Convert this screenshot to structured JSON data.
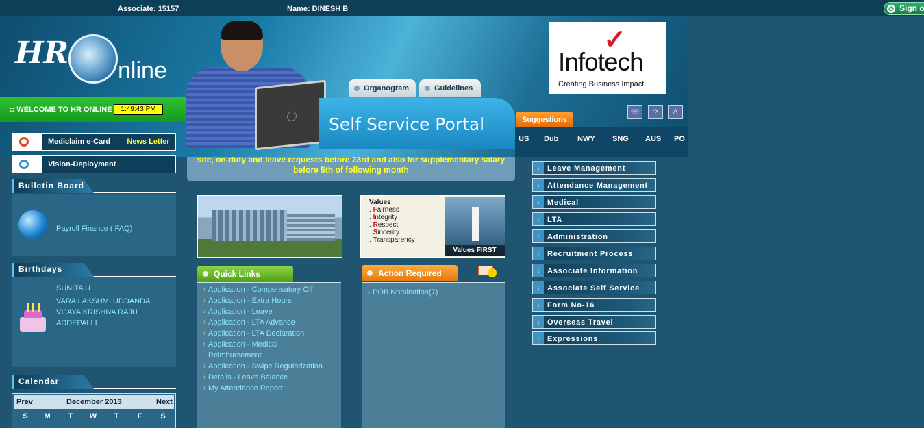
{
  "topbar": {
    "associate": "Associate: 15157",
    "name": "Name: DINESH B",
    "signout": "Sign o"
  },
  "header": {
    "logo_hr": "HR",
    "logo_online": "nline",
    "welcome": ":: WELCOME TO HR ONLINE",
    "clock": "1:49:43 PM",
    "tabs": [
      "Organogram",
      "Guidelines"
    ],
    "portal_title": "Self Service Portal",
    "brand": {
      "name": "Infotech",
      "tagline": "Creating Business Impact"
    },
    "suggestions": "Suggestions",
    "icons": [
      "phone-icon",
      "help-icon",
      "user-icon"
    ],
    "countries": [
      "US",
      "Dub",
      "NWY",
      "SNG",
      "AUS",
      "PO"
    ]
  },
  "ticker": {
    "line1": "site, on-duty and leave requests before 23rd and also for supplementary salary",
    "line2": "before 5th of following month"
  },
  "left": {
    "mediclaim": "Mediclaim e-Card",
    "newsletter": "News Letter",
    "vision": "Vision-Deployment",
    "bulletin_title": "Bulletin Board",
    "bulletin_link": "Payroll Finance ( FAQ)",
    "birthdays_title": "Birthdays",
    "birthdays": [
      "SUNITA U",
      "VARA LAKSHMI UDDANDA",
      "VIJAYA KRISHNA RAJU",
      "ADDEPALLI"
    ],
    "calendar_title": "Calendar",
    "calendar": {
      "prev": "Prev",
      "month": "December 2013",
      "next": "Next",
      "days": [
        "S",
        "M",
        "T",
        "W",
        "T",
        "F",
        "S"
      ]
    }
  },
  "values": {
    "title": "Values",
    "items": [
      {
        "initial": "F",
        "rest": "airness"
      },
      {
        "initial": "I",
        "rest": "ntegrity"
      },
      {
        "initial": "R",
        "rest": "espect"
      },
      {
        "initial": "S",
        "rest": "incerity"
      },
      {
        "initial": "T",
        "rest": "ransparency"
      }
    ],
    "caption": "Values FIRST"
  },
  "quick_links": {
    "title": "Quick Links",
    "items": [
      "Application - Compensatory Off",
      "Application - Extra Hours",
      "Application - Leave",
      "Application - LTA Advance",
      "Application - LTA Declaration",
      "Application - Medical",
      "Reimbursement",
      "Application - Swipe Regularization",
      "Details - Leave Balance",
      "My Attendance Report"
    ]
  },
  "action_required": {
    "title": "Action Required",
    "items": [
      "POB Nomination(7)"
    ]
  },
  "menu": [
    "Leave Management",
    "Attendance Management",
    "Medical",
    "LTA",
    "Administration",
    "Recruitment Process",
    "Associate Information",
    "Associate Self Service",
    "Form No-16",
    "Overseas Travel",
    "Expressions"
  ]
}
